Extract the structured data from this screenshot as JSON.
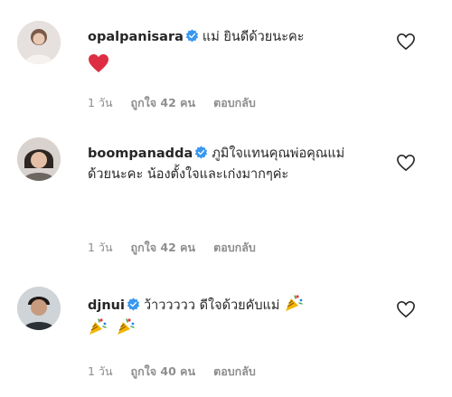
{
  "colors": {
    "text": "#262626",
    "meta": "#8e8e8e",
    "verified": "#3897f0",
    "heart_red": "#ed4956"
  },
  "comments": [
    {
      "username": "opalpanisara",
      "verified": true,
      "text": "แม่ ยินดีด้วยนะคะ",
      "emoji": [
        "red-heart-icon"
      ],
      "time": "1 วัน",
      "likes": "ถูกใจ 42 คน",
      "reply": "ตอบกลับ"
    },
    {
      "username": "boompanadda",
      "verified": true,
      "text": "ภูมิใจแทนคุณพ่อคุณแม่ด้วยนะคะ น้องตั้งใจและเก่งมากๆค่ะ",
      "emoji": [],
      "time": "1 วัน",
      "likes": "ถูกใจ 42 คน",
      "reply": "ตอบกลับ"
    },
    {
      "username": "djnui",
      "verified": true,
      "text": "ว้าววววว ดีใจด้วยคับแม่",
      "emoji": [
        "party-popper-icon",
        "party-popper-icon",
        "party-popper-icon"
      ],
      "time": "1 วัน",
      "likes": "ถูกใจ 40 คน",
      "reply": "ตอบกลับ"
    }
  ]
}
